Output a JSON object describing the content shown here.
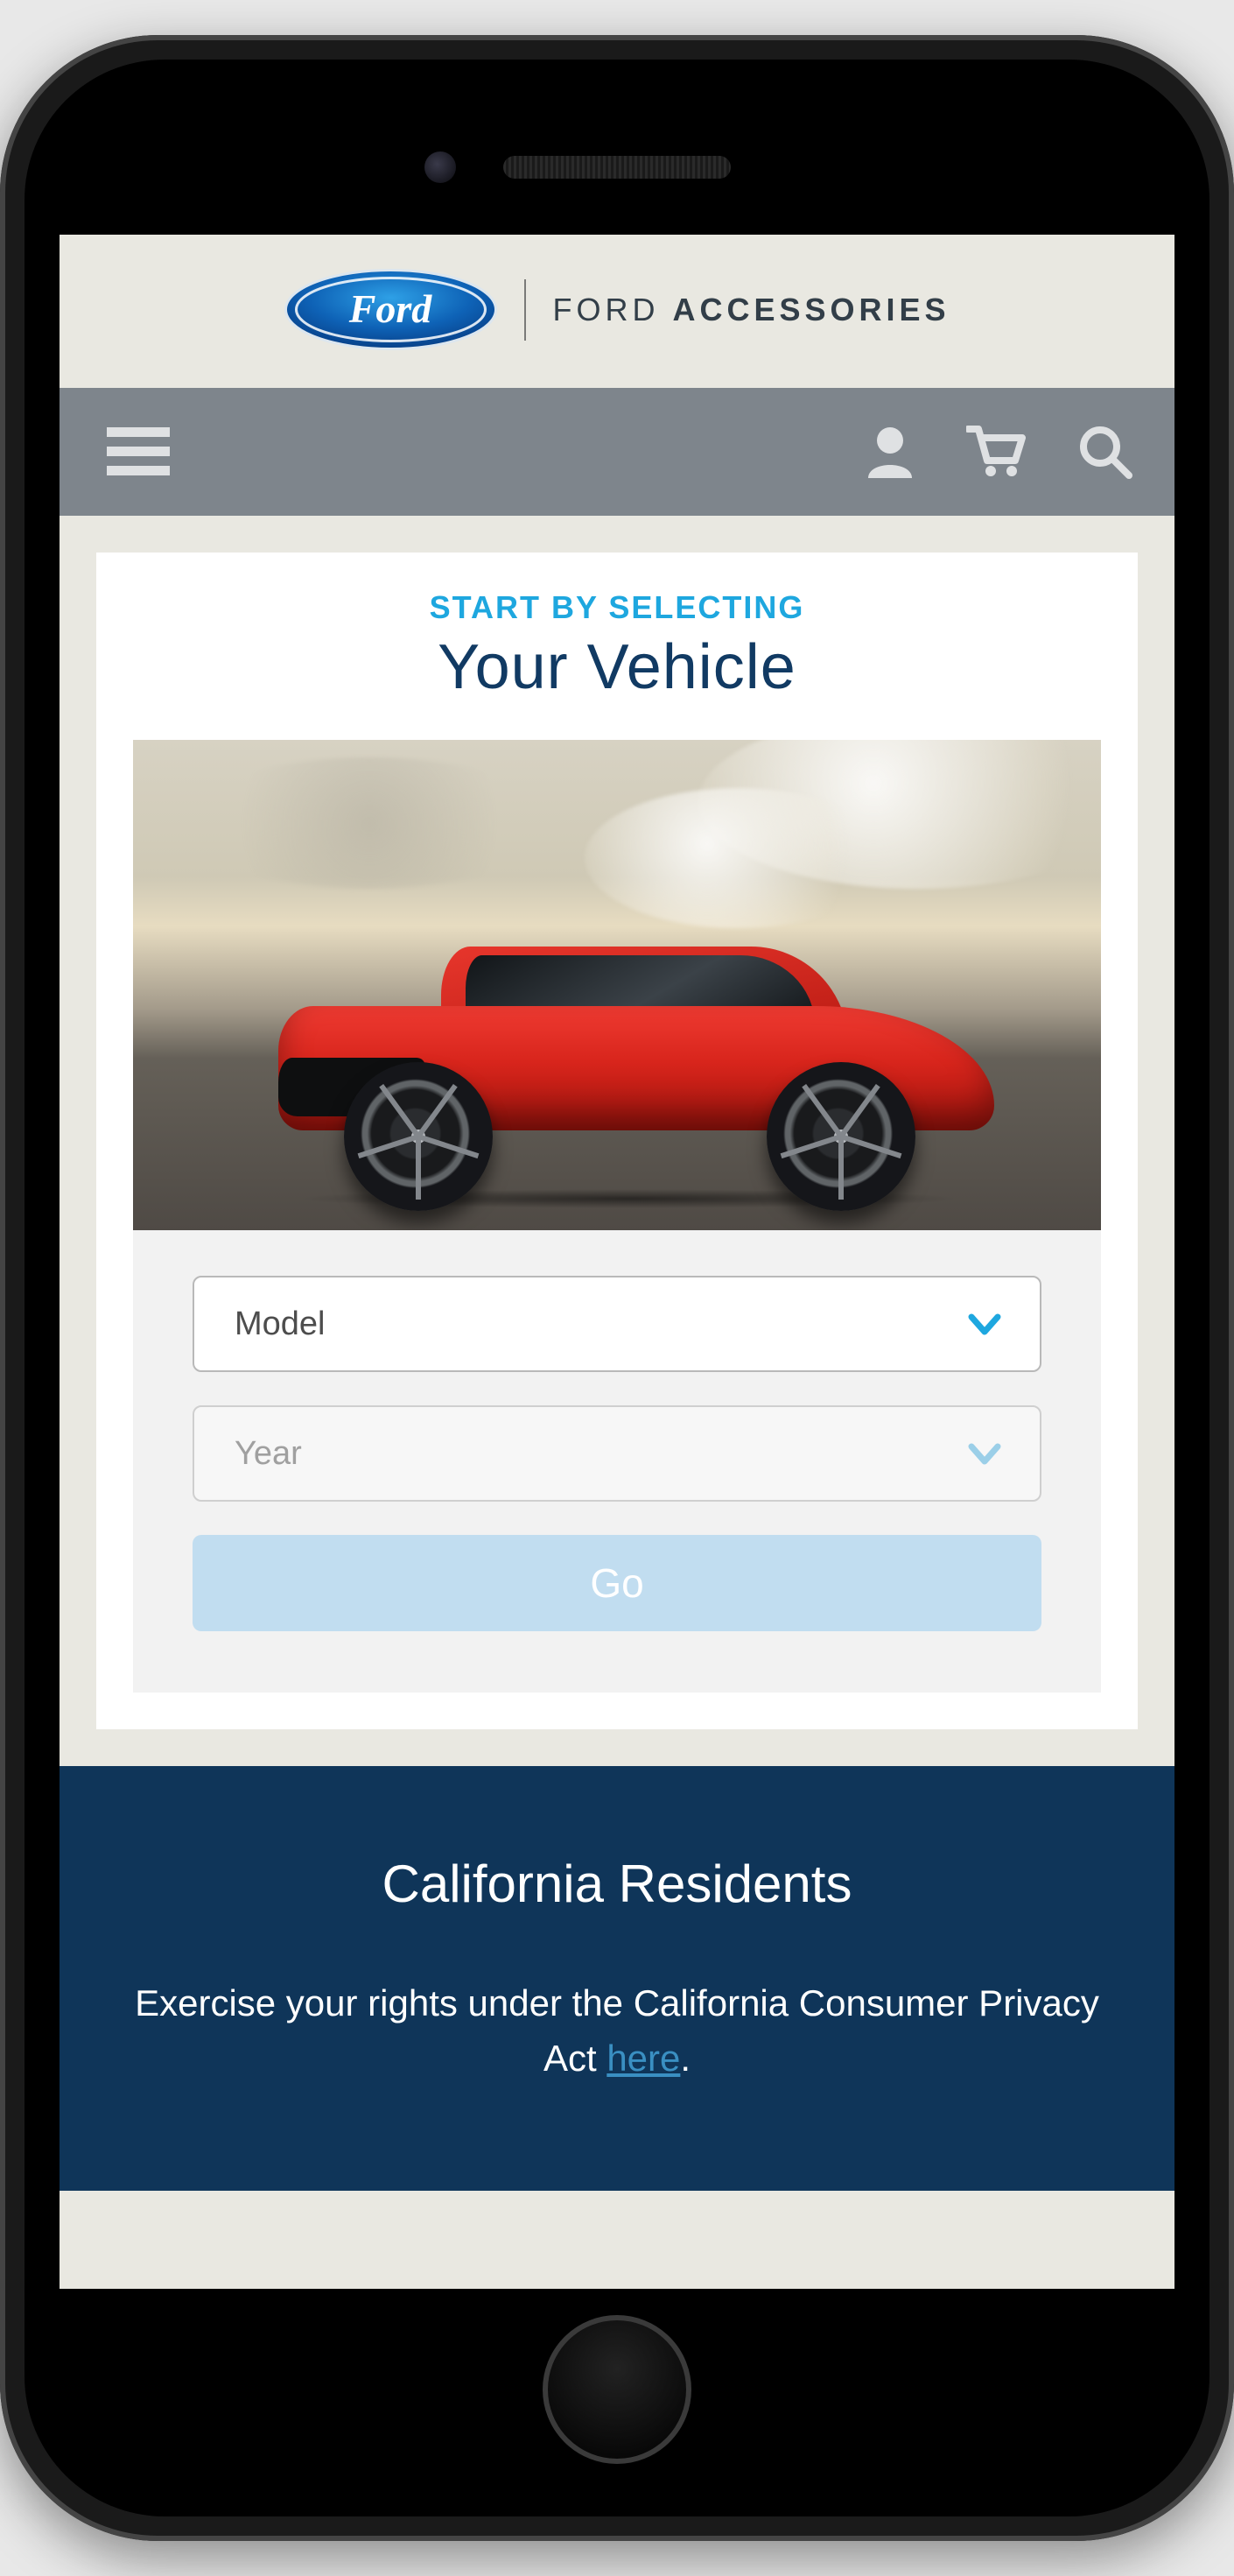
{
  "header": {
    "brand_script": "Ford",
    "brand_text_light": "FORD",
    "brand_text_bold": "ACCESSORIES"
  },
  "nav": {
    "menu_icon": "menu-icon",
    "account_icon": "account-icon",
    "cart_icon": "cart-icon",
    "search_icon": "search-icon"
  },
  "selector_card": {
    "subtitle": "START BY SELECTING",
    "title": "Your Vehicle",
    "model_label": "Model",
    "year_label": "Year",
    "go_label": "Go"
  },
  "footer": {
    "title": "California Residents",
    "text": "Exercise your rights under the California Consumer Privacy Act ",
    "link_text": "here",
    "period": "."
  },
  "colors": {
    "accent_blue": "#1ea7df",
    "title_navy": "#113a63",
    "footer_bg": "#0f3559",
    "car_red": "#d8251c"
  }
}
